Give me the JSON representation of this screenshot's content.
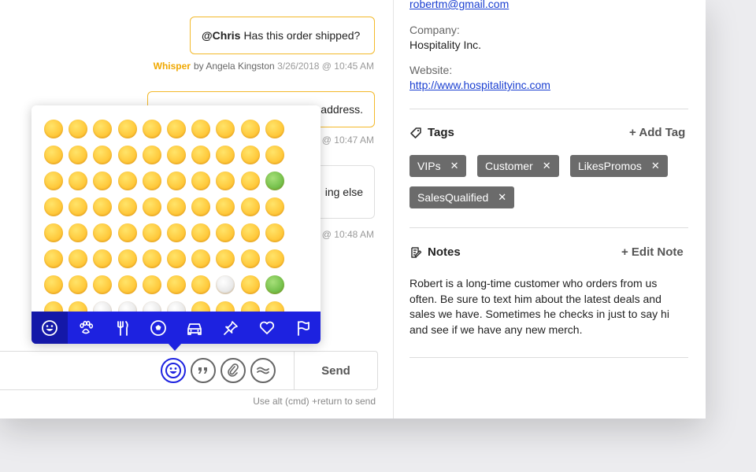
{
  "chat": {
    "messages": [
      {
        "mention": "@Chris",
        "text": "Has this order shipped?",
        "meta_prefix": "Whisper",
        "meta_by": "by Angela Kingston",
        "meta_time": "3/26/2018 @ 10:45 AM"
      },
      {
        "text": "address.",
        "meta_time": "@ 10:47 AM"
      },
      {
        "text": "ing else",
        "meta_time": "@ 10:48 AM"
      }
    ],
    "send_label": "Send",
    "hint": "Use alt (cmd) +return to send"
  },
  "emoji_picker": {
    "tabs": [
      {
        "icon": "smiley-icon"
      },
      {
        "icon": "paw-icon"
      },
      {
        "icon": "fork-knife-icon"
      },
      {
        "icon": "soccer-ball-icon"
      },
      {
        "icon": "car-icon"
      },
      {
        "icon": "pushpin-icon"
      },
      {
        "icon": "heart-icon"
      },
      {
        "icon": "flag-icon"
      }
    ],
    "accent_color": "#1d22e0"
  },
  "contact": {
    "email": "robertm@gmail.com",
    "company_label": "Company:",
    "company": "Hospitality Inc.",
    "website_label": "Website:",
    "website": "http://www.hospitalityinc.com"
  },
  "tags": {
    "title": "Tags",
    "add_label": "+ Add Tag",
    "items": [
      "VIPs",
      "Customer",
      "LikesPromos",
      "SalesQualified"
    ],
    "remove_glyph": "✕"
  },
  "notes": {
    "title": "Notes",
    "edit_label": "+ Edit Note",
    "text": "Robert is a long-time customer who orders from us often. Be sure to text him about the latest deals and sales we have. Sometimes he checks in just to say hi and see if we have any new merch."
  }
}
